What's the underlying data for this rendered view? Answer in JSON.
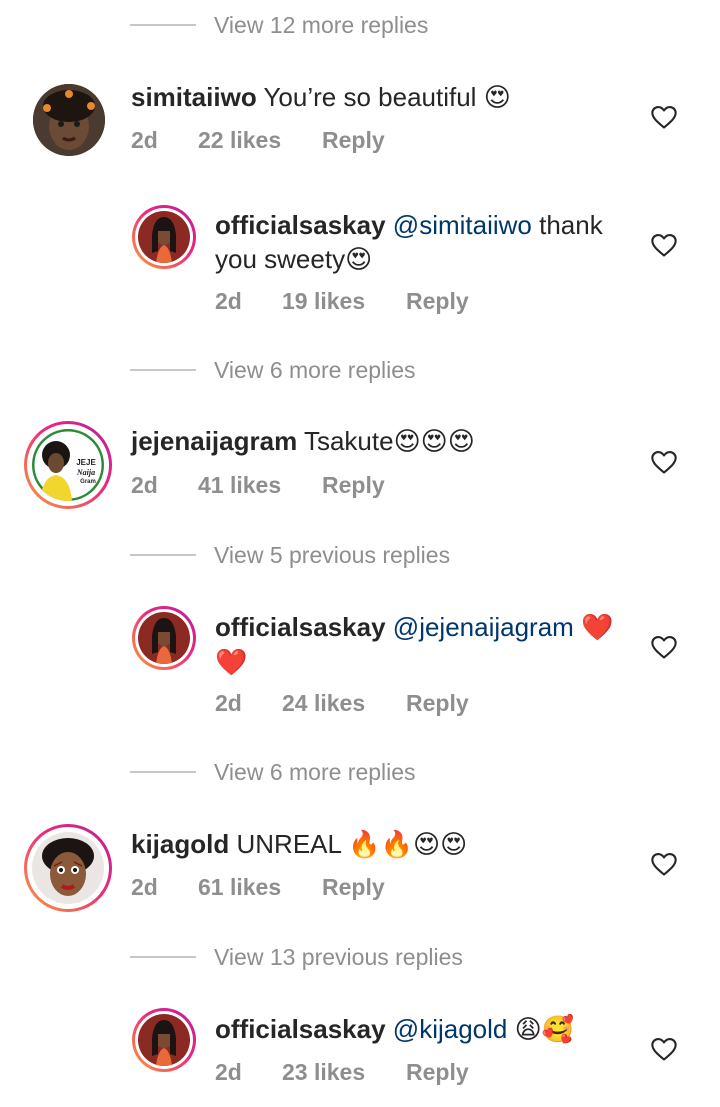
{
  "colors": {
    "text": "#262626",
    "secondary": "#8e8e8e",
    "mention": "#00376b",
    "heart": "#e0171f"
  },
  "view_rows": [
    {
      "label": "View 12 more replies"
    },
    {
      "label": "View 6 more replies"
    },
    {
      "label": "View 5 previous replies"
    },
    {
      "label": "View 6 more replies"
    },
    {
      "label": "View 13 previous replies"
    }
  ],
  "comments": [
    {
      "username": "simitaiiwo",
      "text": "You’re so beautiful",
      "emoji": "😍",
      "time": "2d",
      "likes": "22 likes",
      "reply": "Reply"
    },
    {
      "username": "officialsaskay",
      "mention": "@simitaiiwo",
      "text": "thank",
      "text2": "you sweety",
      "emoji": "😍",
      "time": "2d",
      "likes": "19 likes",
      "reply": "Reply"
    },
    {
      "username": "jejenaijagram",
      "text": "Tsakute",
      "emoji": "😍😍😍",
      "time": "2d",
      "likes": "41 likes",
      "reply": "Reply",
      "avatar_text": {
        "l1": "JEJE",
        "l2": "Naija",
        "l3": "Gram"
      }
    },
    {
      "username": "officialsaskay",
      "mention": "@jejenaijagram",
      "emoji": "❤️",
      "emoji2": "❤️",
      "time": "2d",
      "likes": "24 likes",
      "reply": "Reply"
    },
    {
      "username": "kijagold",
      "text": "UNREAL",
      "emoji": "🔥🔥😍😍",
      "time": "2d",
      "likes": "61 likes",
      "reply": "Reply"
    },
    {
      "username": "officialsaskay",
      "mention": "@kijagold",
      "emoji": "😩🥰",
      "time": "2d",
      "likes": "23 likes",
      "reply": "Reply"
    }
  ]
}
